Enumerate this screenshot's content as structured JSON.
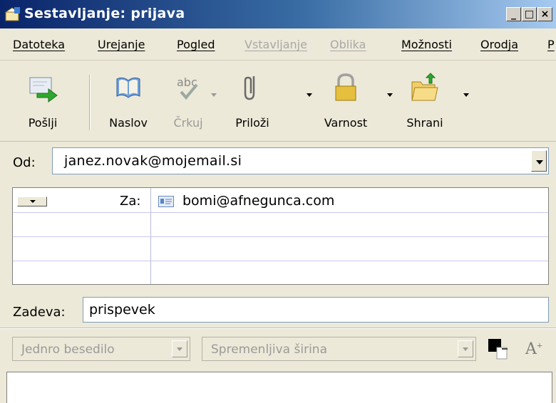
{
  "window": {
    "title": "Sestavljanje: prijava",
    "controls": {
      "minimize": "_",
      "maximize": "□",
      "close": "×"
    }
  },
  "menu": [
    {
      "label": "Datoteka",
      "enabled": true
    },
    {
      "label": "Urejanje",
      "enabled": true
    },
    {
      "label": "Pogled",
      "enabled": true
    },
    {
      "label": "Vstavljanje",
      "enabled": false
    },
    {
      "label": "Oblika",
      "enabled": false
    },
    {
      "label": "Možnosti",
      "enabled": true
    },
    {
      "label": "Orodja",
      "enabled": true
    },
    {
      "label": "P",
      "enabled": true
    }
  ],
  "toolbar": {
    "send": "Pošlji",
    "address": "Naslov",
    "spell": "Črkuj",
    "attach": "Priloži",
    "security": "Varnost",
    "save": "Shrani"
  },
  "from": {
    "label": "Od:",
    "value": "janez.novak@mojemail.si"
  },
  "recipients": [
    {
      "type": "Za:",
      "address": "bomi@afnegunca.com"
    }
  ],
  "subject": {
    "label": "Zadeva:",
    "value": "prispevek"
  },
  "format": {
    "text_mode": "Jednro besedilo",
    "font": "Spremenljiva širina"
  },
  "colors": {
    "title_start": "#0a246a",
    "title_end": "#a6caf0",
    "chrome": "#ece9d8",
    "disabled_text": "#a8a8a8",
    "send_arrow": "#2ea82e"
  }
}
